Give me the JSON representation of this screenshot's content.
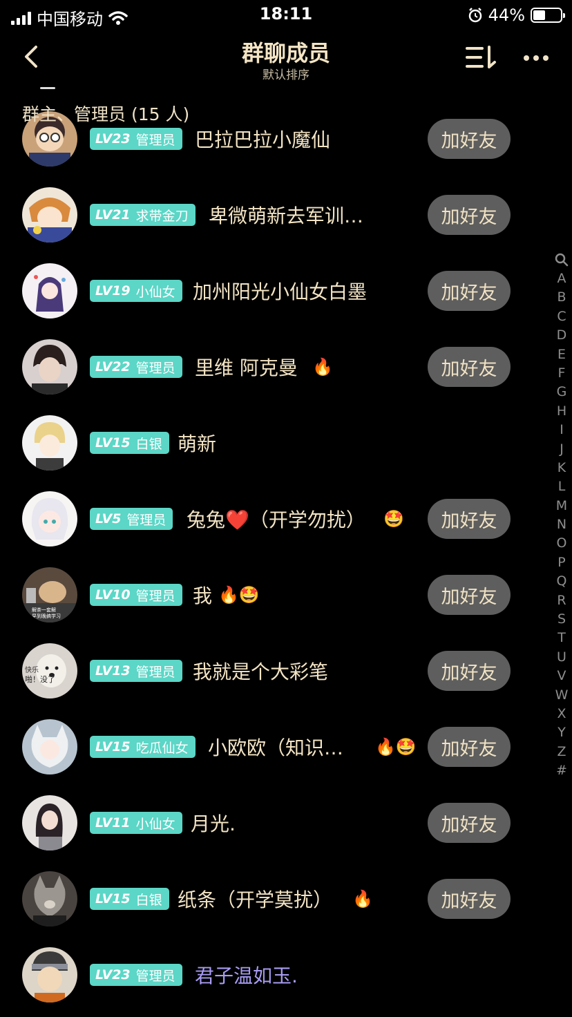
{
  "status_bar": {
    "carrier": "中国移动",
    "time": "18:11",
    "battery": "44%",
    "battery_level": 0.44
  },
  "nav": {
    "title": "群聊成员",
    "subtitle": "默认排序"
  },
  "section": {
    "label": "群主、管理员 (15 人)"
  },
  "colors": {
    "badge": "#5cd6c6",
    "button": "#5e5e5e",
    "text": "#f3e4c4",
    "purple_name": "#a89cf2"
  },
  "members": [
    {
      "lv": "LV23",
      "title": "管理员",
      "name": "巴拉巴拉小魔仙",
      "emojis": "",
      "button": "加好友"
    },
    {
      "lv": "LV21",
      "title": "求带金刀",
      "name": "卑微萌新去军训…",
      "emojis": "",
      "button": "加好友"
    },
    {
      "lv": "LV19",
      "title": "小仙女",
      "name": "加州阳光小仙女白墨",
      "emojis": "",
      "button": "加好友"
    },
    {
      "lv": "LV22",
      "title": "管理员",
      "name": "里维 阿克曼",
      "emojis": "🔥",
      "button": "加好友"
    },
    {
      "lv": "LV15",
      "title": "白银",
      "name": "萌新",
      "emojis": "",
      "button": ""
    },
    {
      "lv": "LV5",
      "title": "管理员",
      "name": "兔兔❤️（开学勿扰）",
      "emojis": "🤩",
      "button": "加好友"
    },
    {
      "lv": "LV10",
      "title": "管理员",
      "name": "我",
      "emojis": "🔥🤩",
      "button": "加好友"
    },
    {
      "lv": "LV13",
      "title": "管理员",
      "name": "我就是个大彩笔",
      "emojis": "",
      "button": "加好友"
    },
    {
      "lv": "LV15",
      "title": "吃瓜仙女",
      "name": "小欧欧（知识…",
      "emojis": "🔥🤩",
      "button": "加好友"
    },
    {
      "lv": "LV11",
      "title": "小仙女",
      "name": "月光.",
      "emojis": "",
      "button": "加好友"
    },
    {
      "lv": "LV15",
      "title": "白银",
      "name": "纸条（开学莫扰）",
      "emojis": "🔥",
      "button": "加好友"
    },
    {
      "lv": "LV23",
      "title": "管理员",
      "name": "君子温如玉.",
      "emojis": "",
      "button": ""
    }
  ],
  "index": [
    "A",
    "B",
    "C",
    "D",
    "E",
    "F",
    "G",
    "H",
    "I",
    "J",
    "K",
    "L",
    "M",
    "N",
    "O",
    "P",
    "Q",
    "R",
    "S",
    "T",
    "U",
    "V",
    "W",
    "X",
    "Y",
    "Z",
    "#"
  ],
  "avatar_text": {
    "cat_caption": "解茶一套解\n早到晚搞学习",
    "dog_caption_1": "快乐",
    "dog_caption_2": "啪！没了"
  }
}
